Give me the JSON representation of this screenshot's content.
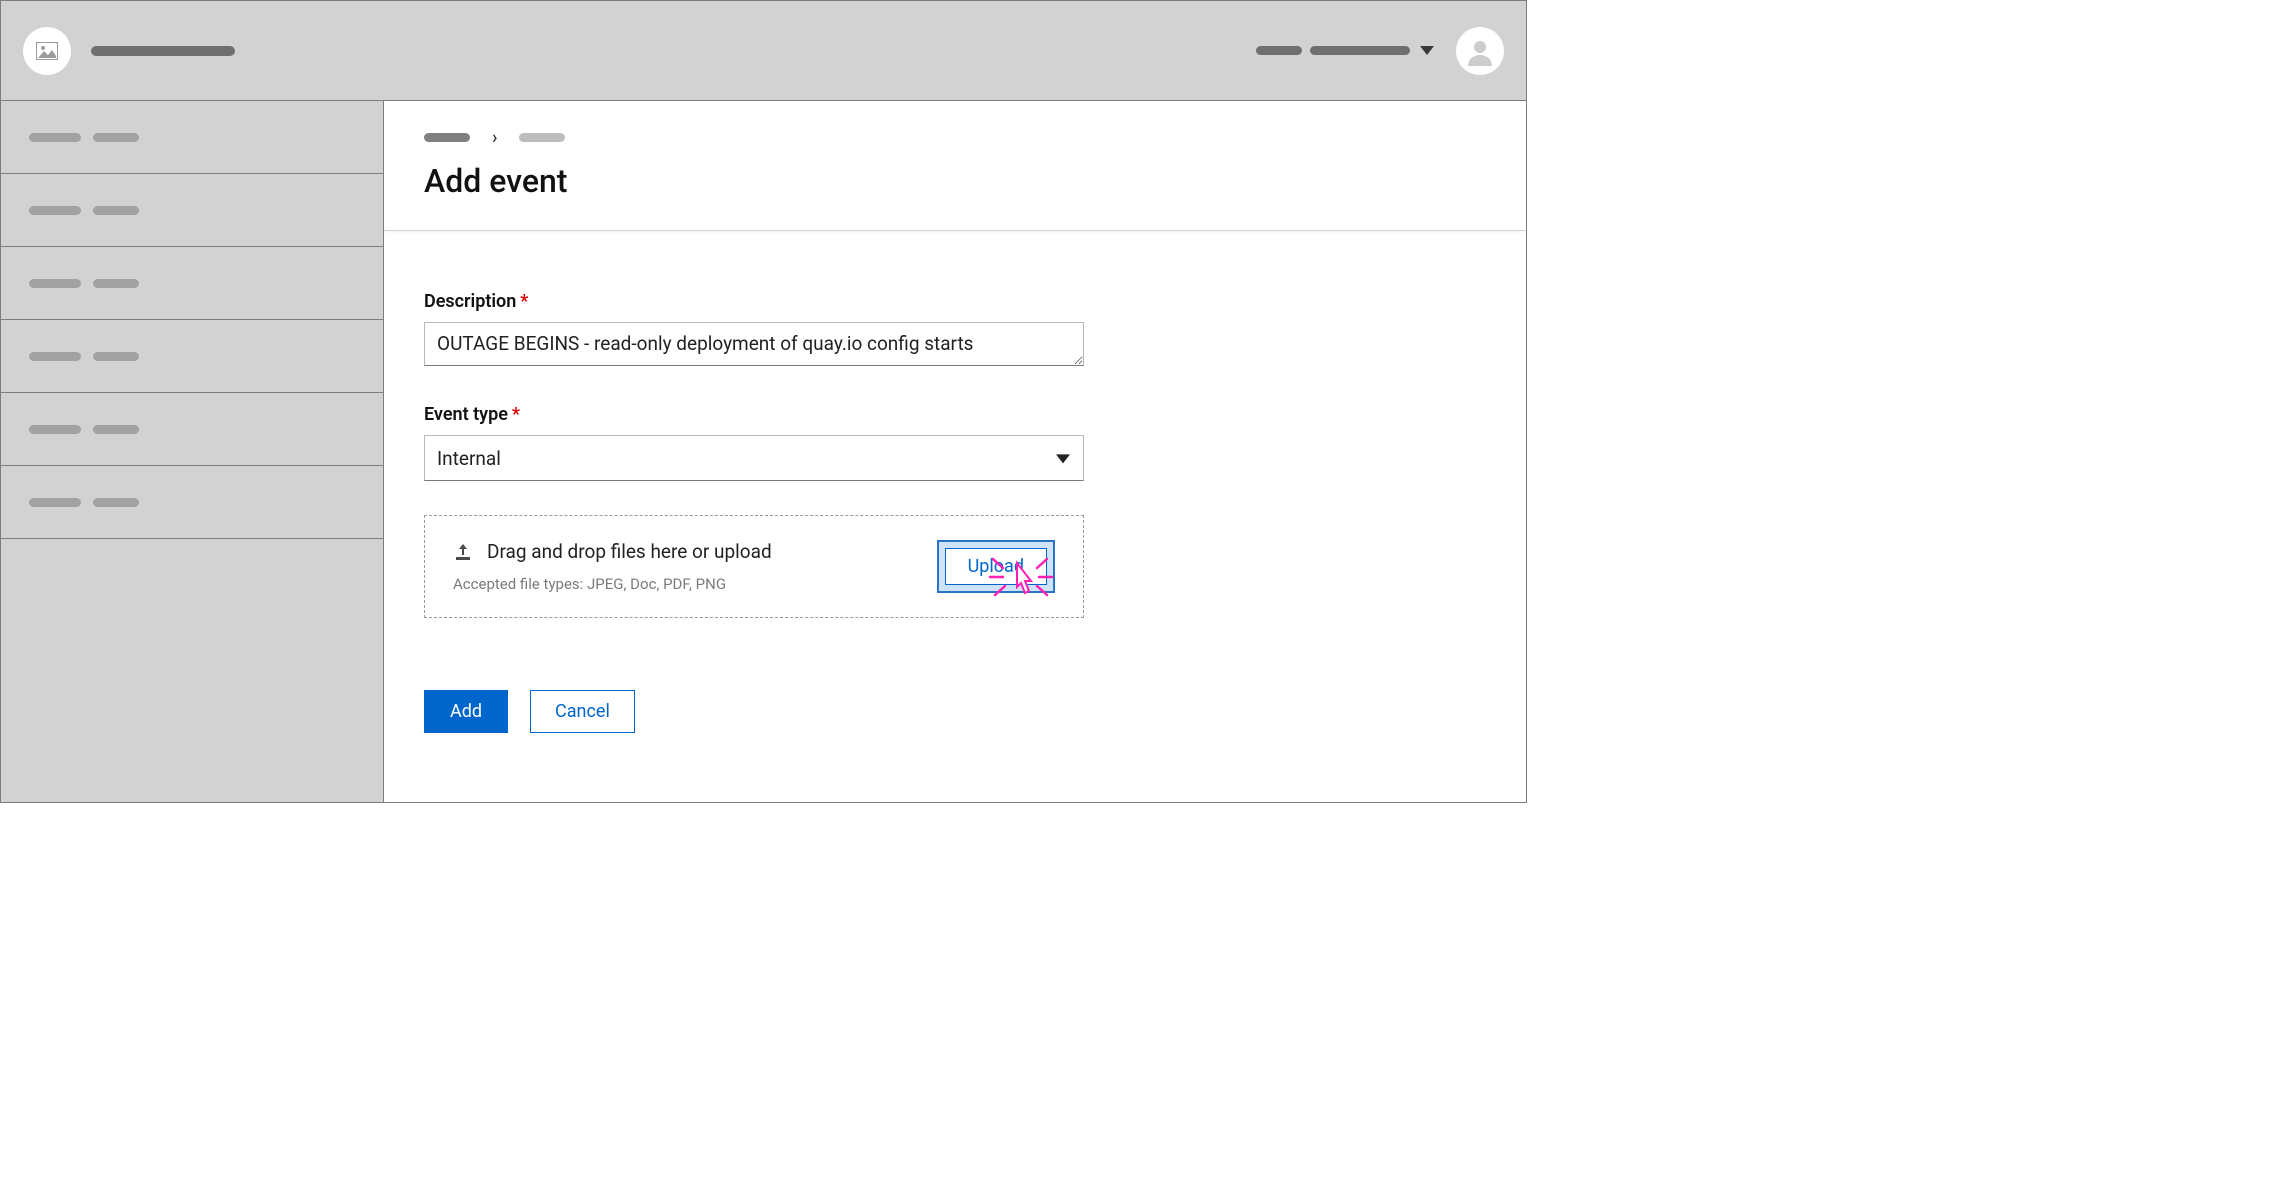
{
  "page": {
    "title": "Add event"
  },
  "form": {
    "description_label": "Description",
    "description_value": "OUTAGE BEGINS - read-only deployment of quay.io config starts",
    "event_type_label": "Event type",
    "event_type_value": "Internal",
    "dropzone_text": "Drag and drop files here or upload",
    "dropzone_hint": "Accepted file types: JPEG, Doc, PDF, PNG",
    "upload_label": "Upload"
  },
  "actions": {
    "add_label": "Add",
    "cancel_label": "Cancel"
  }
}
